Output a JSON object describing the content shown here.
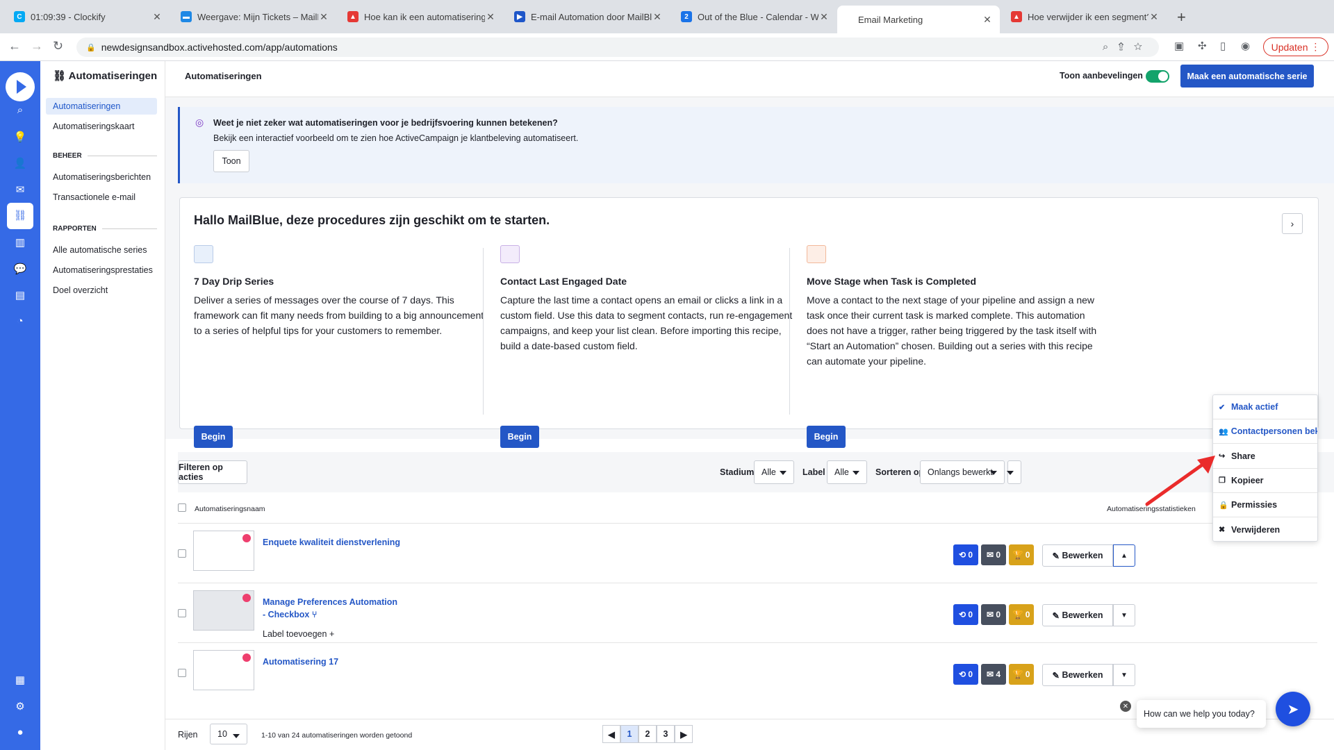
{
  "browser": {
    "tabs": [
      {
        "title": "01:09:39 - Clockify",
        "color": "#03a9f4",
        "glyph": "C"
      },
      {
        "title": "Weergave: Mijn Tickets – MailB",
        "color": "#1e88e5",
        "glyph": "▬"
      },
      {
        "title": "Hoe kan ik een automatisering",
        "color": "#e53935",
        "glyph": "▲"
      },
      {
        "title": "E-mail Automation door MailBl",
        "color": "#1e56c9",
        "glyph": "▶"
      },
      {
        "title": "Out of the Blue - Calendar - W",
        "color": "#1a73e8",
        "glyph": "2"
      },
      {
        "title": "Email Marketing",
        "color": "#ffffff",
        "glyph": ""
      },
      {
        "title": "Hoe verwijder ik een segment?",
        "color": "#e53935",
        "glyph": "▲"
      }
    ],
    "new_tab": "+",
    "url": "newdesignsandbox.activehosted.com/app/automations",
    "update_label": "Updaten"
  },
  "rail": {
    "icons": [
      "search-icon",
      "lightbulb-icon",
      "contacts-icon",
      "campaigns-icon",
      "automations-icon",
      "deals-icon",
      "conversations-icon",
      "website-icon",
      "reports-icon"
    ],
    "bottom_icons": [
      "apps-icon",
      "settings-icon",
      "user-icon"
    ]
  },
  "subnav": {
    "header": "Automatiseringen",
    "items": [
      "Automatiseringen",
      "Automatiseringskaart"
    ],
    "section_beheer": "BEHEER",
    "beheer_items": [
      "Automatiseringsberichten",
      "Transactionele e-mail"
    ],
    "section_rapporten": "RAPPORTEN",
    "rapporten_items": [
      "Alle automatische series",
      "Automatiseringsprestaties",
      "Doel overzicht"
    ]
  },
  "topbar": {
    "title": "Automatiseringen",
    "toggle_label": "Toon aanbevelingen",
    "toggle_on": true,
    "create_button": "Maak een automatische serie"
  },
  "banner": {
    "title": "Weet je niet zeker wat automatiseringen voor je bedrijfsvoering kunnen betekenen?",
    "description": "Bekijk een interactief voorbeeld om te zien hoe ActiveCampaign je klantbeleving automatiseert.",
    "button": "Toon"
  },
  "recipes": {
    "title": "Hallo MailBlue, deze procedures zijn geschikt om te starten.",
    "items": [
      {
        "name": "7 Day Drip Series",
        "description": "Deliver a series of messages over the course of 7 days. This framework can fit many needs from building to a big announcement to a series of helpful tips for your customers to remember.",
        "button": "Begin"
      },
      {
        "name": "Contact Last Engaged Date",
        "description": "Capture the last time a contact opens an email or clicks a link in a custom field. Use this data to segment contacts, run re-engagement campaigns, and keep your list clean. Before importing this recipe, build a date-based custom field.",
        "button": "Begin"
      },
      {
        "name": "Move Stage when Task is Completed",
        "description": "Move a contact to the next stage of your pipeline and assign a new task once their current task is marked complete. This automation does not have a trigger, rather being triggered by the task itself with “Start an Automation” chosen. Building out a series with this recipe can automate your pipeline.",
        "button": "Begin"
      }
    ]
  },
  "filters": {
    "filter_button": "Filteren op acties",
    "stage_label": "Stadium",
    "stage_value": "Alle",
    "label_label": "Label",
    "label_value": "Alle",
    "sort_label": "Sorteren op",
    "sort_value": "Onlangs bewerkt"
  },
  "table": {
    "col_name": "Automatiseringsnaam",
    "col_stats": "Automatiseringsstatistieken",
    "rows": [
      {
        "name": "Enquete kwaliteit dienstverlening",
        "stats": [
          "0",
          "0",
          "0"
        ],
        "edit": "Bewerken",
        "open": true
      },
      {
        "name": "Manage Preferences Automation - Checkbox",
        "label_add": "Label toevoegen",
        "stats": [
          "0",
          "0",
          "0"
        ],
        "edit": "Bewerken",
        "open": false
      },
      {
        "name": "Automatisering 17",
        "stats": [
          "0",
          "4",
          "0"
        ],
        "edit": "Bewerken",
        "open": false
      }
    ]
  },
  "menu": {
    "items": [
      {
        "label": "Maak actief",
        "icon": "check-circle-icon",
        "glyph": "✔",
        "blue": true
      },
      {
        "label": "Contactpersonen bekijken",
        "icon": "contacts-icon",
        "glyph": "👥",
        "blue": true
      },
      {
        "label": "Share",
        "icon": "share-icon",
        "glyph": "↪",
        "blue": false
      },
      {
        "label": "Kopieer",
        "icon": "copy-icon",
        "glyph": "❐",
        "blue": false
      },
      {
        "label": "Permissies",
        "icon": "lock-icon",
        "glyph": "🔒",
        "blue": false
      },
      {
        "label": "Verwijderen",
        "icon": "delete-icon",
        "glyph": "✖",
        "blue": false
      }
    ]
  },
  "footer": {
    "rows_label": "Rijen",
    "rows_value": "10",
    "summary": "1-10 van 24 automatiseringen worden getoond",
    "pages": [
      "1",
      "2",
      "3"
    ],
    "current_page": "1"
  },
  "chat": {
    "prompt": "How can we help you today?"
  }
}
